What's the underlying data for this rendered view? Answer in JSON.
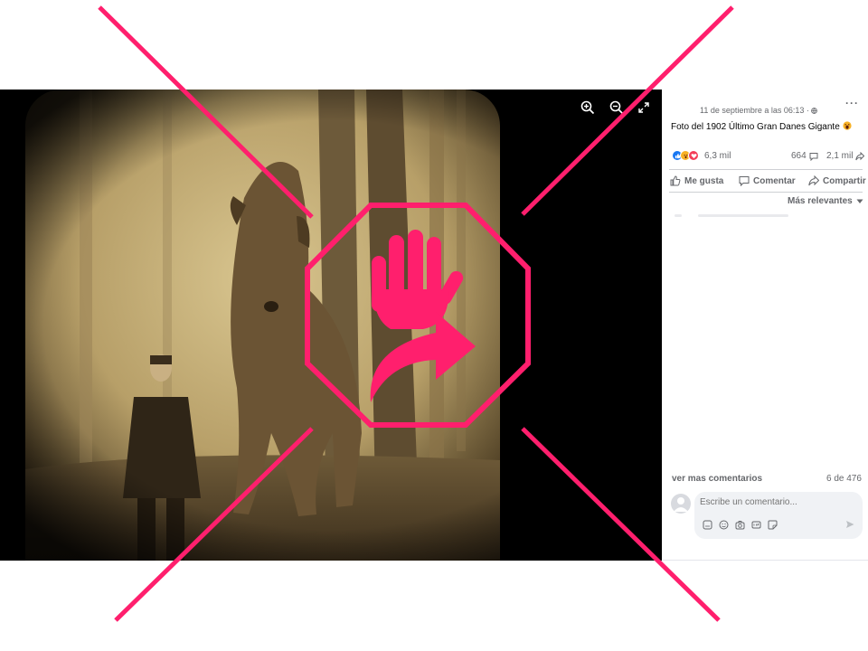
{
  "post": {
    "timestamp": "11 de septiembre a las 06:13 · ",
    "text": "Foto del 1902 Último Gran Danes Gigante",
    "more_label": "···"
  },
  "reactions": {
    "icons": [
      "like-icon",
      "wow-icon",
      "love-icon"
    ],
    "count": "6,3 mil",
    "comments": "664",
    "shares": "2,1 mil"
  },
  "actions": {
    "like_label": "Me gusta",
    "comment_label": "Comentar",
    "share_label": "Compartir"
  },
  "comments": {
    "sort_label": "Más relevantes",
    "see_more_label": "ver mas comentarios",
    "count_label": "6 de 476",
    "input_placeholder": "Escribe un comentario..."
  },
  "viewer": {
    "icons": [
      "zoom-in-icon",
      "zoom-out-icon",
      "fullscreen-icon"
    ]
  },
  "overlay": {
    "stamp_icon": "stop-hand-share-icon",
    "color": "#ff1f6d"
  }
}
